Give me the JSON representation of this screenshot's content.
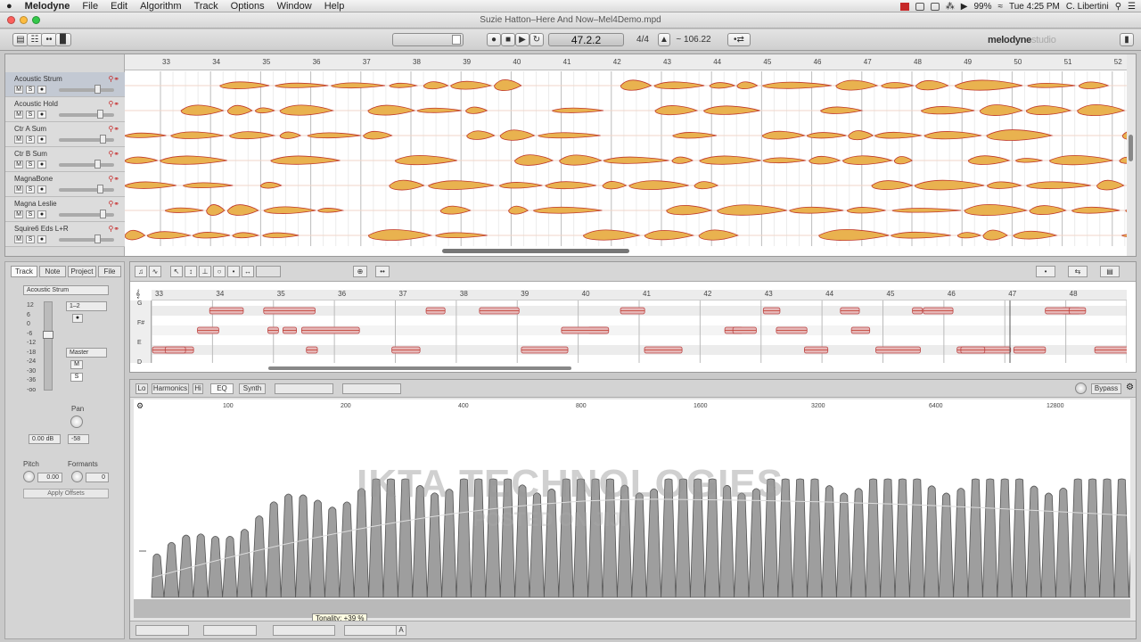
{
  "menubar": {
    "apple": "",
    "app": "Melodyne",
    "items": [
      "File",
      "Edit",
      "Algorithm",
      "Track",
      "Options",
      "Window",
      "Help"
    ],
    "battery": "99%",
    "clock": "Tue 4:25 PM",
    "user": "C. Libertini"
  },
  "window": {
    "title": "Suzie Hatton–Here And Now–Mel4Demo.mpd"
  },
  "toolbar": {
    "position": "47.2.2",
    "signature": "4/4",
    "tempo": "~ 106.22",
    "logo": "melodyne",
    "logo_sub": "studio"
  },
  "tracks": [
    {
      "name": "Acoustic Strum",
      "selected": true
    },
    {
      "name": "Acoustic Hold",
      "selected": false
    },
    {
      "name": "Ctr A Sum",
      "selected": false
    },
    {
      "name": "Ctr B Sum",
      "selected": false
    },
    {
      "name": "MagnaBone",
      "selected": false
    },
    {
      "name": "Magna Leslie",
      "selected": false
    },
    {
      "name": "Squire6 Eds L+R",
      "selected": false
    }
  ],
  "track_buttons": {
    "mute": "M",
    "solo": "S"
  },
  "arrangement": {
    "bars": [
      "33",
      "34",
      "35",
      "36",
      "37",
      "38",
      "39",
      "40",
      "41",
      "42",
      "43",
      "44",
      "45",
      "46",
      "47",
      "48",
      "49",
      "50",
      "51",
      "52"
    ]
  },
  "inspector": {
    "tabs": [
      "Track",
      "Note",
      "Project",
      "File"
    ],
    "active_tab": "Track",
    "track_name": "Acoustic Strum",
    "db_scale": [
      "12",
      "6",
      "0",
      "-6",
      "-12",
      "-18",
      "-24",
      "-30",
      "-36",
      "-oo"
    ],
    "channels": "1–2",
    "output": "Master",
    "mute": "M",
    "solo": "S",
    "pan_label": "Pan",
    "volume": "0.00 dB",
    "pan_value": "-58",
    "pitch_label": "Pitch",
    "formants_label": "Formants",
    "pitch_value": "0.00",
    "formants_value": "0",
    "apply": "Apply Offsets"
  },
  "note_editor": {
    "bars": [
      "33",
      "34",
      "35",
      "36",
      "37",
      "38",
      "39",
      "40",
      "41",
      "42",
      "43",
      "44",
      "45",
      "46",
      "47",
      "48"
    ],
    "keys": [
      "G",
      "F#",
      "E",
      "D"
    ]
  },
  "sound_editor": {
    "tabs": [
      "Lo",
      "Harmonics",
      "Hi",
      "EQ",
      "Synth"
    ],
    "active_tab": "EQ",
    "bypass": "Bypass",
    "freqs": [
      "100",
      "200",
      "400",
      "800",
      "1600",
      "3200",
      "6400",
      "12800"
    ],
    "tooltip": "Tonality: +39 %"
  },
  "watermark": {
    "line1": "IKTA TECHNOLOGIES",
    "line2": "POSTED ON JIJI"
  },
  "colors": {
    "blob": "#e9b24f",
    "blob_edge": "#c0392b",
    "accent": "#c62828"
  }
}
